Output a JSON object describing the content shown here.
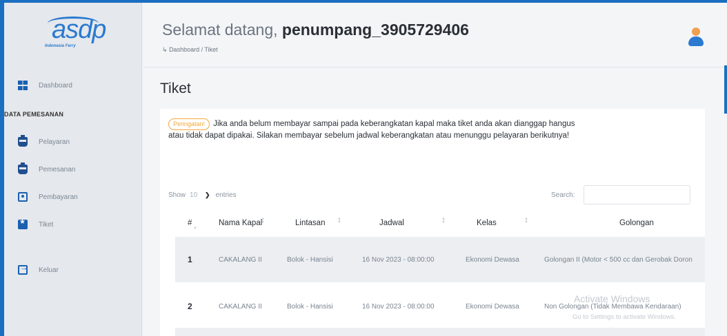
{
  "sidebar": {
    "logo": {
      "word": "asdp",
      "tagline": "Indonesia Ferry"
    },
    "items": [
      {
        "label": "Dashboard",
        "icon": "dashboard-icon"
      },
      {
        "label": "Pelayaran",
        "icon": "ship-icon"
      },
      {
        "label": "Pemesanan",
        "icon": "ship-icon"
      },
      {
        "label": "Pembayaran",
        "icon": "payment-icon"
      },
      {
        "label": "Tiket",
        "icon": "ticket-icon"
      },
      {
        "label": "Keluar",
        "icon": "logout-icon"
      }
    ],
    "section_title": "DATA PEMESANAN"
  },
  "header": {
    "welcome_prefix": "Selamat datang,",
    "username": "penumpang_3905729406",
    "breadcrumb_arrow": "↳",
    "breadcrumb": "Dashboard / Tiket"
  },
  "main": {
    "title": "Tiket",
    "warning_badge": "Peringatan!",
    "warning_text": "Jika anda belum membayar sampai pada keberangkatan kapal maka tiket anda akan dianggap hangus atau tidak dapat dipakai. Silakan membayar sebelum jadwal keberangkatan atau menunggu pelayaran berikutnya!",
    "show_label": "Show",
    "entries_value": "10",
    "entries_label": "entries",
    "search_label": "Search:",
    "search_value": ""
  },
  "table": {
    "headers": [
      "#",
      "Nama Kapal",
      "Lintasan",
      "Jadwal",
      "Kelas",
      "Golongan"
    ],
    "rows": [
      {
        "no": "1",
        "kapal": "CAKALANG II",
        "lintasan": "Bolok - Hansisi",
        "jadwal": "16 Nov 2023 - 08:00:00",
        "kelas": "Ekonomi Dewasa",
        "golongan": "Golongan II (Motor < 500 cc dan Gerobak Doron"
      },
      {
        "no": "2",
        "kapal": "CAKALANG II",
        "lintasan": "Bolok - Hansisi",
        "jadwal": "16 Nov 2023 - 08:00:00",
        "kelas": "Ekonomi Dewasa",
        "golongan": "Non Golongan (Tidak Membawa Kendaraan)"
      }
    ]
  },
  "watermark": {
    "line1": "Activate Windows",
    "line2": "Go to Settings to activate Windows."
  },
  "colors": {
    "accent": "#1a6fc0",
    "warning": "#f3a73b",
    "sidebar_bg": "#e5e8ec"
  }
}
